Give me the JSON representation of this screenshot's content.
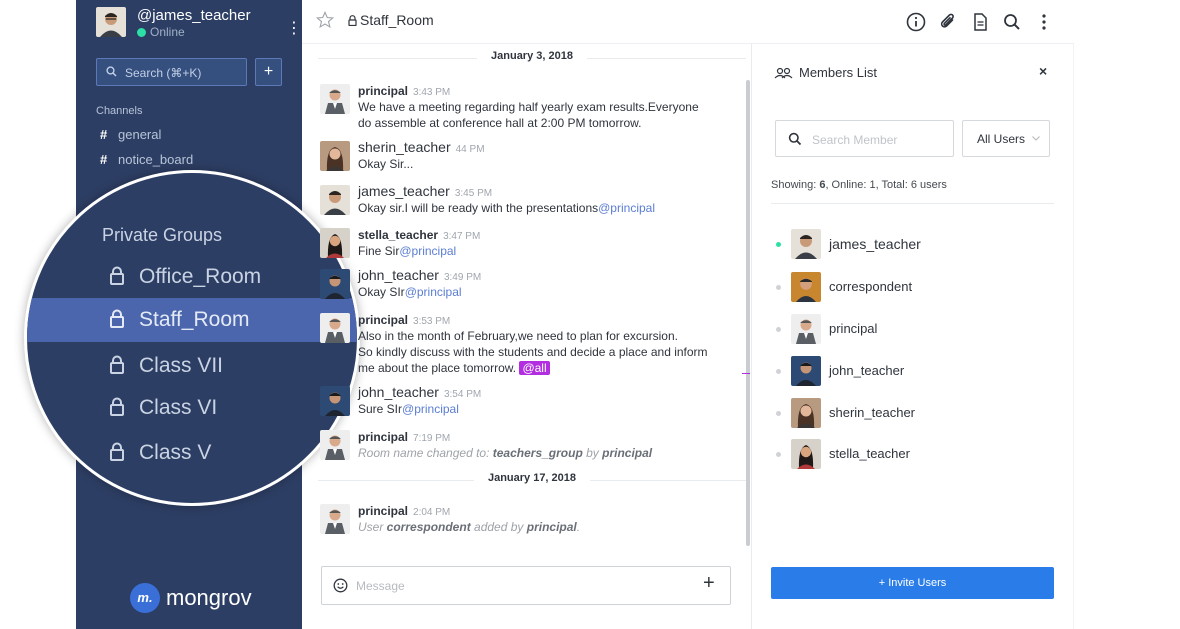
{
  "colors": {
    "sidebar_bg": "#2d3e64",
    "active_item": "#4b66ad",
    "accent_blue": "#2a7de9",
    "online_green": "#2de0a5",
    "mention_purple": "#b32ee1"
  },
  "sidebar": {
    "username": "@james_teacher",
    "status": "Online",
    "search_placeholder": "Search (⌘+K)",
    "add_label": "+",
    "channels_title": "Channels",
    "channels": [
      "general",
      "notice_board"
    ],
    "brand_logo": "m.",
    "brand_name": "mongrov"
  },
  "magnifier": {
    "title": "Private Groups",
    "groups": [
      "Office_Room",
      "Staff_Room",
      "Class VII",
      "Class VI",
      "Class V"
    ]
  },
  "header": {
    "room": "Staff_Room",
    "icons": [
      "info-icon",
      "paperclip-icon",
      "file-icon",
      "search-icon",
      "kebab-icon"
    ]
  },
  "messages": {
    "date1": "January 3, 2018",
    "date2": "January 17, 2018",
    "items": [
      {
        "user": "principal",
        "time": "3:43 PM",
        "line1": "We have a meeting regarding half yearly exam results.Everyone",
        "line2": "do assemble at conference hall at 2:00 PM tomorrow."
      },
      {
        "user": "sherin_teacher",
        "time": "44 PM",
        "text": "Okay Sir..."
      },
      {
        "user": "james_teacher",
        "time": "3:45 PM",
        "text": "Okay sir.I will be ready with the presentations",
        "mention": "@principal"
      },
      {
        "user": "stella_teacher",
        "time": "3:47 PM",
        "text": "Fine Sir",
        "mention": "@principal"
      },
      {
        "user": "john_teacher",
        "time": "3:49 PM",
        "text": "Okay SIr",
        "mention": "@principal"
      },
      {
        "user": "principal",
        "time": "3:53 PM",
        "line1": "Also in the month of February,we need to plan for excursion.",
        "line2": "So kindly discuss with the students and decide a place and inform",
        "line3": "me about the place tomorrow.",
        "mention": "@all"
      },
      {
        "user": "john_teacher",
        "time": "3:54 PM",
        "text": "Sure SIr",
        "mention": "@principal"
      },
      {
        "user": "principal",
        "time": "7:19 PM",
        "sys_pre": "Room name changed to: ",
        "sys_b1": "teachers_group",
        "sys_mid": " by ",
        "sys_b2": "principal"
      },
      {
        "user": "principal",
        "time": "2:04 PM",
        "sys_pre": "User ",
        "sys_b1": "correspondent",
        "sys_mid": " added by ",
        "sys_b2": "principal",
        "sys_post": "."
      }
    ]
  },
  "composer": {
    "placeholder": "Message",
    "plus": "+"
  },
  "members": {
    "title": "Members List",
    "close": "×",
    "search_placeholder": "Search Member",
    "filter": "All Users",
    "showing_label": "Showing: ",
    "showing_count": "6",
    "showing_rest": ", Online: 1, Total: 6 users",
    "list": [
      "james_teacher",
      "correspondent",
      "principal",
      "john_teacher",
      "sherin_teacher",
      "stella_teacher"
    ],
    "invite": "+ Invite Users"
  }
}
